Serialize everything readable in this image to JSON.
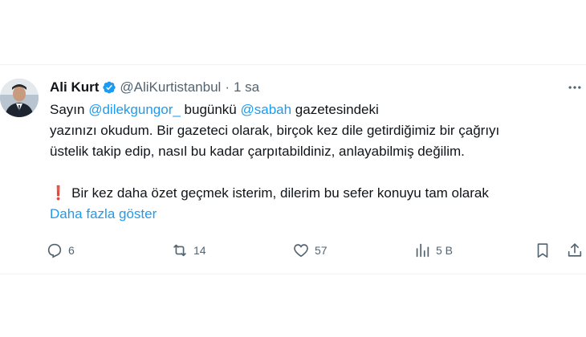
{
  "tweet": {
    "author_name": "Ali Kurt",
    "handle": "@AliKurtistanbul",
    "separator": "·",
    "time": "1 sa",
    "line1_prefix": "Sayın ",
    "mention_1": "@dilekgungor_",
    "line1_middle": " bugünkü ",
    "mention_2": "@sabah",
    "line1_suffix": " gazetesindeki",
    "line2": "yazınızı okudum. Bir gazeteci olarak, birçok kez dile getirdiğimiz bir çağrıyı",
    "line3": "üstelik takip edip, nasıl bu kadar çarpıtabildiniz, anlayabilmiş değilim.",
    "excl_mark": "❗",
    "line4": "Bir kez daha özet geçmek isterim, dilerim bu sefer konuyu tam olarak",
    "show_more": "Daha fazla göster"
  },
  "actions": {
    "replies": "6",
    "reposts": "14",
    "likes": "57",
    "views": "5 B"
  },
  "icons": {
    "verified": "verified-badge-icon",
    "more": "more-dots-icon",
    "reply": "reply-icon",
    "repost": "repost-icon",
    "like": "heart-icon",
    "views": "views-icon",
    "bookmark": "bookmark-icon",
    "share": "share-icon"
  },
  "colors": {
    "accent": "#1d9bf0",
    "muted": "#536471",
    "text": "#0f1419"
  }
}
